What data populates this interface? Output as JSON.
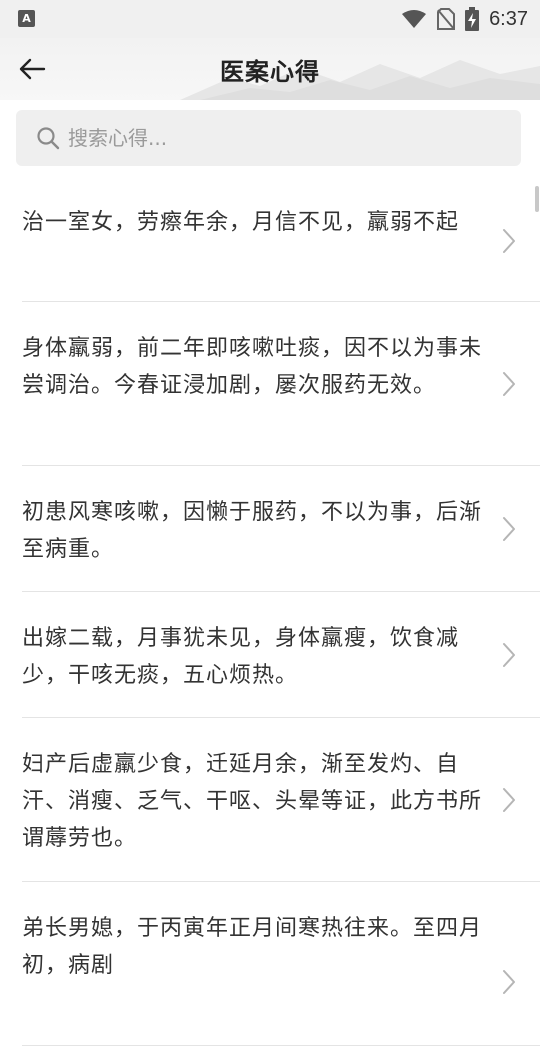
{
  "status_bar": {
    "left_icon_label": "A",
    "time": "6:37",
    "icons": [
      "wifi-icon",
      "no-sim-icon",
      "battery-charging-icon"
    ]
  },
  "header": {
    "title": "医案心得",
    "back_icon": "arrow-left-icon"
  },
  "search": {
    "placeholder": "搜索心得...",
    "value": "",
    "icon": "search-icon"
  },
  "list": {
    "items": [
      {
        "text": "治一室女，劳瘵年余，月信不见，羸弱不起"
      },
      {
        "text": "身体羸弱，前二年即咳嗽吐痰，因不以为事未尝调治。今春证浸加剧，屡次服药无效。"
      },
      {
        "text": "初患风寒咳嗽，因懒于服药，不以为事，后渐至病重。"
      },
      {
        "text": "出嫁二载，月事犹未见，身体羸瘦，饮食减少，干咳无痰，五心烦热。"
      },
      {
        "text": "妇产后虚羸少食，迁延月余，渐至发灼、自汗、消瘦、乏气、干呕、头晕等证，此方书所谓蓐劳也。"
      },
      {
        "text": "弟长男媳，于丙寅年正月间寒热往来。至四月初，病剧"
      }
    ]
  }
}
